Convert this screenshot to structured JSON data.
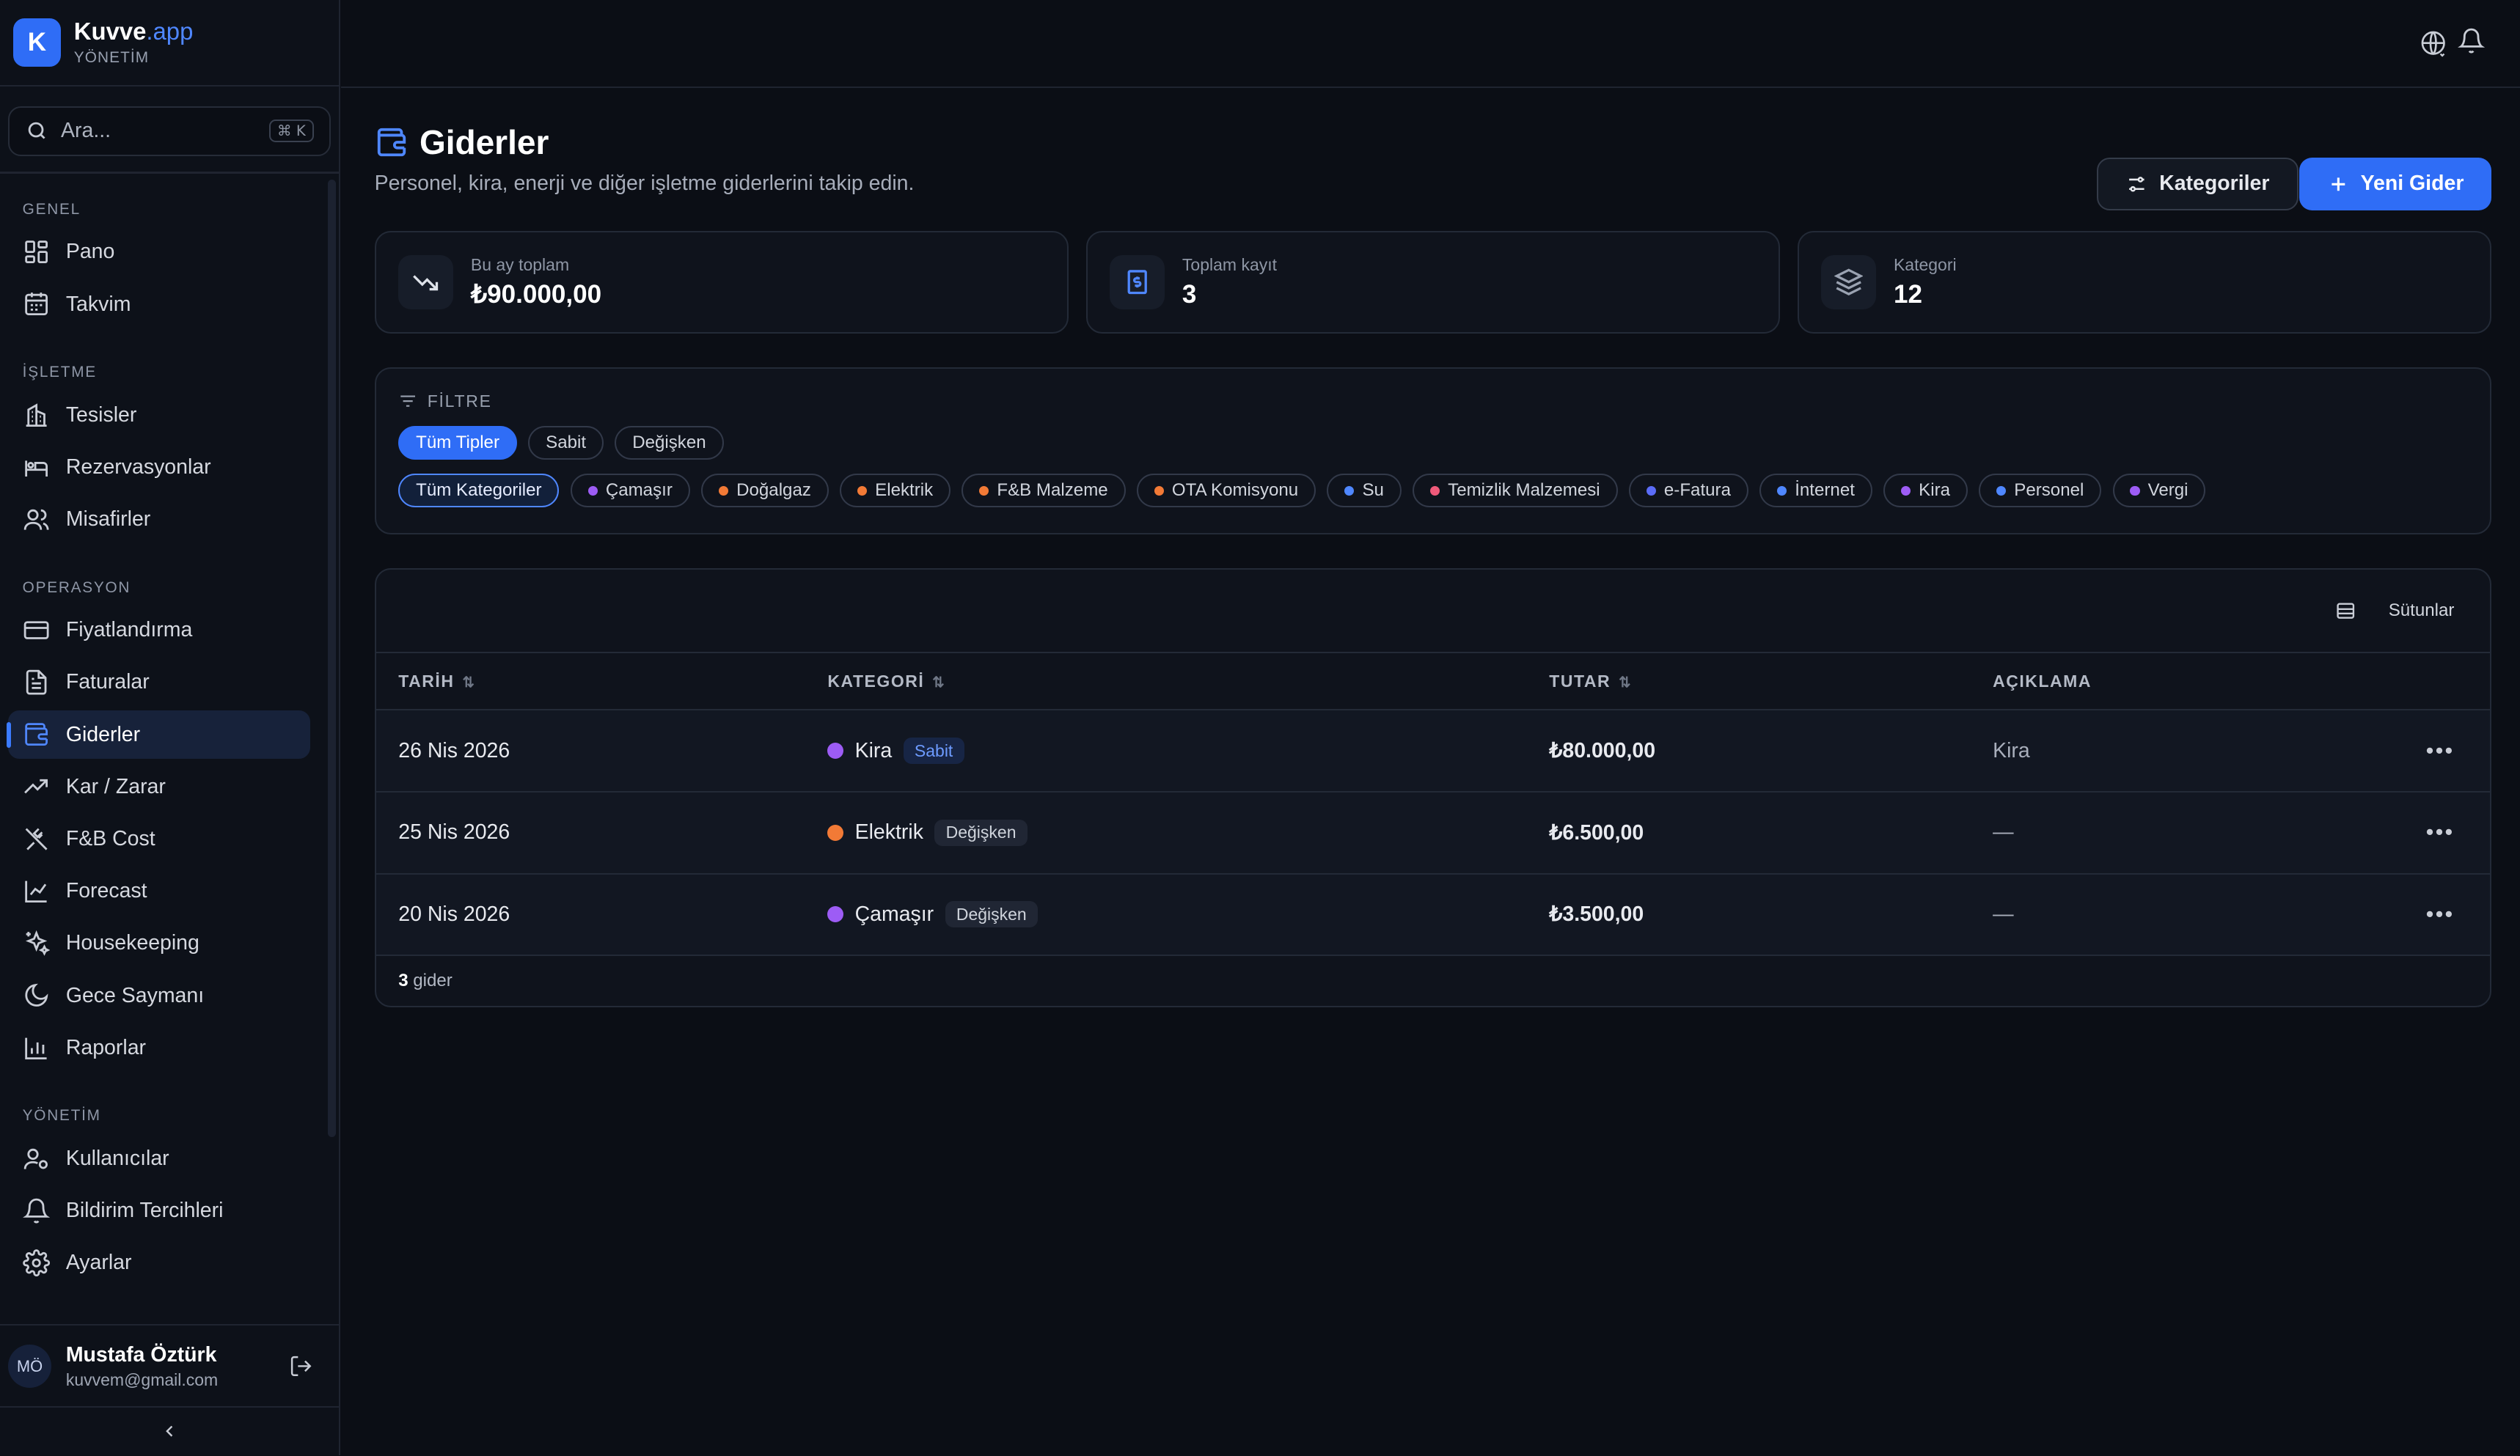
{
  "brand": {
    "logo_letter": "K",
    "name": "Kuvve",
    "name_accent": ".app",
    "subtitle": "YÖNETİM"
  },
  "search": {
    "placeholder": "Ara...",
    "shortcut": "⌘ K"
  },
  "sidebar": {
    "sections": [
      {
        "label": "GENEL",
        "items": [
          {
            "label": "Pano",
            "icon": "dashboard-icon"
          },
          {
            "label": "Takvim",
            "icon": "calendar-icon"
          }
        ]
      },
      {
        "label": "İŞLETME",
        "items": [
          {
            "label": "Tesisler",
            "icon": "building-icon"
          },
          {
            "label": "Rezervasyonlar",
            "icon": "bed-icon"
          },
          {
            "label": "Misafirler",
            "icon": "users-icon"
          }
        ]
      },
      {
        "label": "OPERASYON",
        "items": [
          {
            "label": "Fiyatlandırma",
            "icon": "credit-card-icon"
          },
          {
            "label": "Faturalar",
            "icon": "file-icon"
          },
          {
            "label": "Giderler",
            "icon": "wallet-icon",
            "active": true
          },
          {
            "label": "Kar / Zarar",
            "icon": "trending-up-icon"
          },
          {
            "label": "F&B Cost",
            "icon": "utensils-icon"
          },
          {
            "label": "Forecast",
            "icon": "line-chart-icon"
          },
          {
            "label": "Housekeeping",
            "icon": "sparkles-icon"
          },
          {
            "label": "Gece Saymanı",
            "icon": "moon-icon"
          },
          {
            "label": "Raporlar",
            "icon": "bar-chart-icon"
          }
        ]
      },
      {
        "label": "YÖNETİM",
        "items": [
          {
            "label": "Kullanıcılar",
            "icon": "user-cog-icon"
          },
          {
            "label": "Bildirim Tercihleri",
            "icon": "bell-icon"
          },
          {
            "label": "Ayarlar",
            "icon": "gear-icon"
          }
        ]
      }
    ]
  },
  "user": {
    "initials": "MÖ",
    "name": "Mustafa Öztürk",
    "email": "kuvvem@gmail.com"
  },
  "page": {
    "title": "Giderler",
    "subtitle": "Personel, kira, enerji ve diğer işletme giderlerini takip edin.",
    "categories_button": "Kategoriler",
    "new_button": "Yeni Gider"
  },
  "stats": [
    {
      "label": "Bu ay toplam",
      "value": "₺90.000,00",
      "icon": "trending-down-icon"
    },
    {
      "label": "Toplam kayıt",
      "value": "3",
      "icon": "receipt-icon"
    },
    {
      "label": "Kategori",
      "value": "12",
      "icon": "layers-icon"
    }
  ],
  "filter": {
    "title": "FİLTRE",
    "types": [
      "Tüm Tipler",
      "Sabit",
      "Değişken"
    ],
    "categories": [
      {
        "label": "Tüm Kategoriler"
      },
      {
        "label": "Çamaşır",
        "color": "#9d5cf5"
      },
      {
        "label": "Doğalgaz",
        "color": "#f27a36"
      },
      {
        "label": "Elektrik",
        "color": "#f27a36"
      },
      {
        "label": "F&B Malzeme",
        "color": "#f27a36"
      },
      {
        "label": "OTA Komisyonu",
        "color": "#f27a36"
      },
      {
        "label": "Su",
        "color": "#4f87ff"
      },
      {
        "label": "Temizlik Malzemesi",
        "color": "#ef5a7a"
      },
      {
        "label": "e-Fatura",
        "color": "#5b6cf7"
      },
      {
        "label": "İnternet",
        "color": "#4f87ff"
      },
      {
        "label": "Kira",
        "color": "#9d5cf5"
      },
      {
        "label": "Personel",
        "color": "#4f87ff"
      },
      {
        "label": "Vergi",
        "color": "#9d5cf5"
      }
    ]
  },
  "table": {
    "columns_button": "Sütunlar",
    "headers": [
      "TARİH",
      "KATEGORİ",
      "TUTAR",
      "AÇIKLAMA"
    ],
    "rows": [
      {
        "date": "26 Nis 2026",
        "category": "Kira",
        "color": "#9d5cf5",
        "type": "Sabit",
        "amount": "₺80.000,00",
        "description": "Kira"
      },
      {
        "date": "25 Nis 2026",
        "category": "Elektrik",
        "color": "#f27a36",
        "type": "Değişken",
        "amount": "₺6.500,00",
        "description": "—"
      },
      {
        "date": "20 Nis 2026",
        "category": "Çamaşır",
        "color": "#9d5cf5",
        "type": "Değişken",
        "amount": "₺3.500,00",
        "description": "—"
      }
    ],
    "footer_count": "3",
    "footer_label": "gider"
  }
}
